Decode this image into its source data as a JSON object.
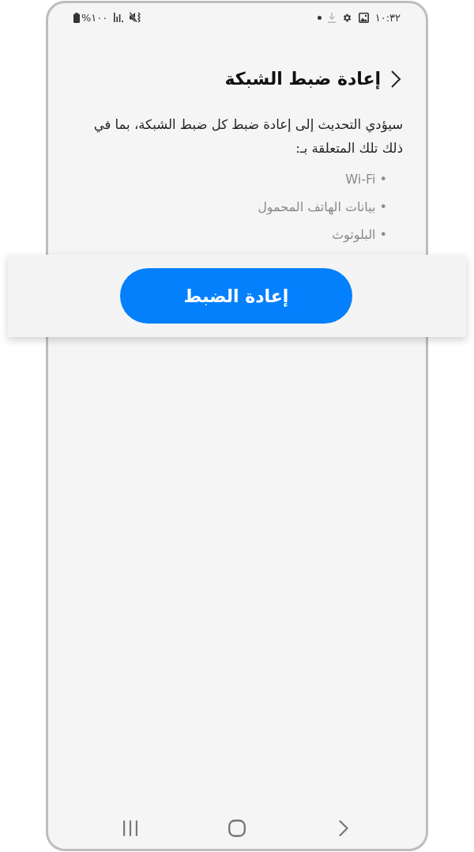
{
  "status_bar": {
    "battery_percentage": "%١٠٠",
    "time": "١٠:٣٢"
  },
  "header": {
    "title": "إعادة ضبط الشبكة"
  },
  "description": "سيؤدي التحديث إلى إعادة ضبط كل ضبط الشبكة، بما في ذلك تلك المتعلقة بـ:",
  "items": [
    "• Wi-Fi",
    "• بيانات الهاتف المحمول",
    "• البلوتوث"
  ],
  "action": {
    "label": "إعادة الضبط"
  }
}
